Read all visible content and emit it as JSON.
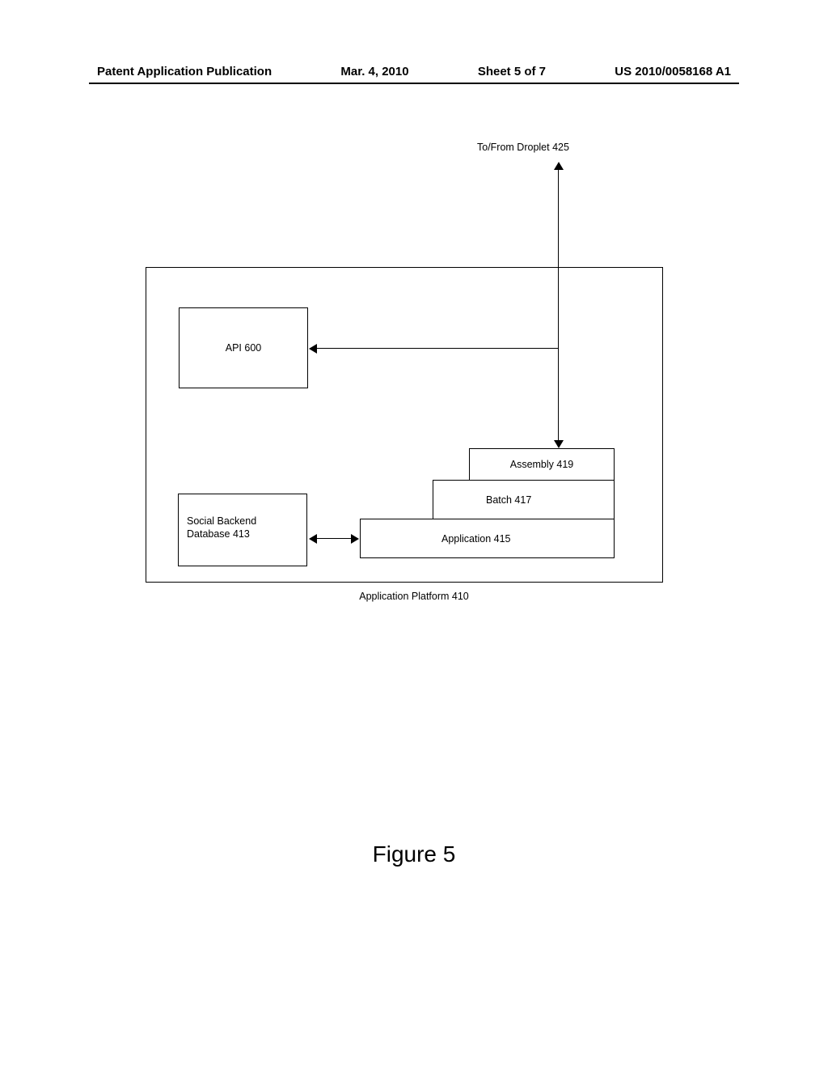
{
  "header": {
    "pub_type": "Patent Application Publication",
    "date": "Mar. 4, 2010",
    "sheet": "Sheet 5 of 7",
    "pub_number": "US 2010/0058168 A1"
  },
  "diagram": {
    "droplet_label": "To/From Droplet 425",
    "platform_label": "Application Platform  410",
    "api": "API   600",
    "social_db_line1": "Social Backend",
    "social_db_line2": "Database 413",
    "assembly": "Assembly  419",
    "batch": "Batch  417",
    "application": "Application  415"
  },
  "figure_label": "Figure 5"
}
